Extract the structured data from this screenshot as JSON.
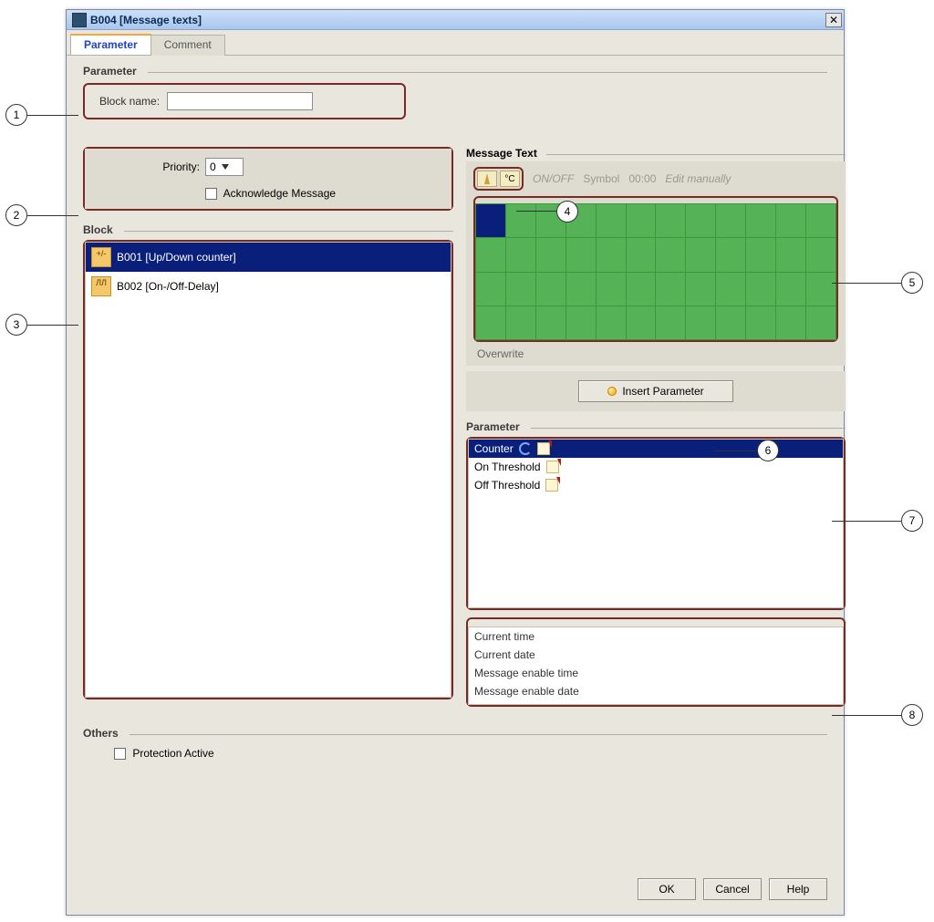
{
  "window": {
    "title": "B004 [Message texts]",
    "close_glyph": "✕"
  },
  "tabs": {
    "parameter": "Parameter",
    "comment": "Comment"
  },
  "parameter_section": {
    "heading": "Parameter",
    "block_name_label": "Block name:",
    "block_name_value": ""
  },
  "priority_panel": {
    "priority_label": "Priority:",
    "priority_value": "0",
    "ack_label": "Acknowledge Message",
    "ack_checked": false
  },
  "block_section": {
    "heading": "Block",
    "items": [
      {
        "label": "B001 [Up/Down counter]",
        "selected": true
      },
      {
        "label": "B002 [On-/Off-Delay]",
        "selected": false
      }
    ]
  },
  "message_text": {
    "heading": "Message Text",
    "toolbar_degc": "°C",
    "disabled_hints": [
      "ON/OFF",
      "Symbol",
      "00:00",
      "Edit manually"
    ],
    "overwrite_label": "Overwrite",
    "insert_button": "Insert Parameter"
  },
  "parameter_list": {
    "heading": "Parameter",
    "items": [
      {
        "label": "Counter",
        "selected": true,
        "icons": [
          "refresh",
          "pencil"
        ]
      },
      {
        "label": "On Threshold",
        "selected": false,
        "icons": [
          "pencil"
        ]
      },
      {
        "label": "Off Threshold",
        "selected": false,
        "icons": [
          "pencil"
        ]
      }
    ]
  },
  "extra_list": {
    "items": [
      "Current time",
      "Current date",
      "Message enable time",
      "Message enable date"
    ]
  },
  "others": {
    "heading": "Others",
    "protection_label": "Protection Active",
    "protection_checked": false
  },
  "footer": {
    "ok": "OK",
    "cancel": "Cancel",
    "help": "Help"
  },
  "callouts": {
    "c1": "1",
    "c2": "2",
    "c3": "3",
    "c4": "4",
    "c5": "5",
    "c6": "6",
    "c7": "7",
    "c8": "8"
  }
}
